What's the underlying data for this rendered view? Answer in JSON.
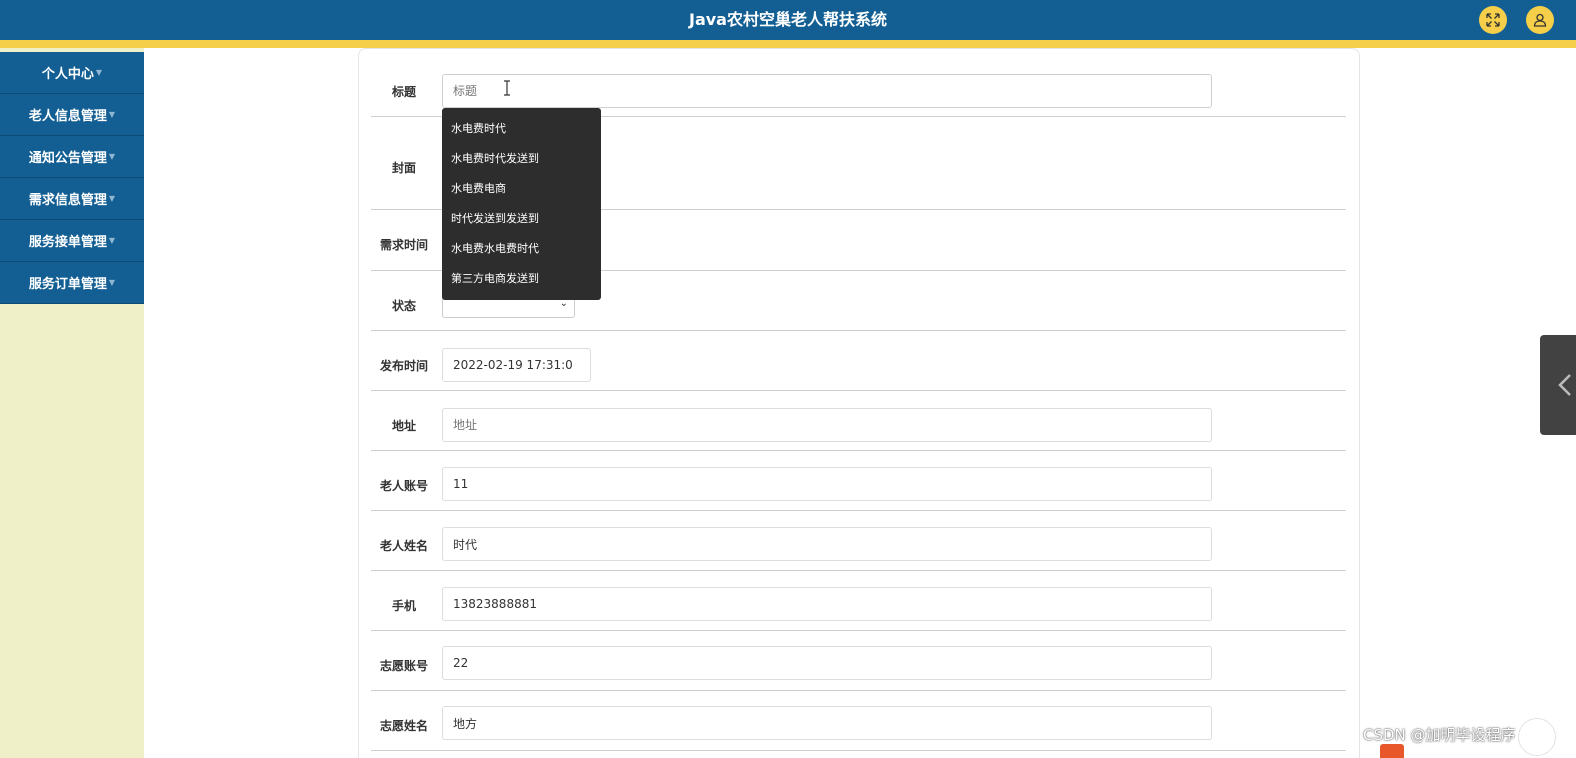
{
  "header": {
    "title": "Java农村空巢老人帮扶系统",
    "fullscreen_icon": "expand-icon",
    "user_icon": "user-icon"
  },
  "sidebar": {
    "items": [
      {
        "label": "个人中心"
      },
      {
        "label": "老人信息管理"
      },
      {
        "label": "通知公告管理"
      },
      {
        "label": "需求信息管理"
      },
      {
        "label": "服务接单管理"
      },
      {
        "label": "服务订单管理"
      }
    ]
  },
  "form": {
    "title": {
      "label": "标题",
      "placeholder": "标题",
      "value": ""
    },
    "cover": {
      "label": "封面"
    },
    "demand_time": {
      "label": "需求时间"
    },
    "status": {
      "label": "状态",
      "value": ""
    },
    "publish_time": {
      "label": "发布时间",
      "value": "2022-02-19 17:31:0"
    },
    "address": {
      "label": "地址",
      "placeholder": "地址",
      "value": ""
    },
    "elder_account": {
      "label": "老人账号",
      "value": "11"
    },
    "elder_name": {
      "label": "老人姓名",
      "value": "时代"
    },
    "phone": {
      "label": "手机",
      "value": "13823888881"
    },
    "volunteer_account": {
      "label": "志愿账号",
      "value": "22"
    },
    "volunteer_name": {
      "label": "志愿姓名",
      "value": "地方"
    }
  },
  "autocomplete": {
    "items": [
      "水电费时代",
      "水电费时代发送到",
      "水电费电商",
      "时代发送到发送到",
      "水电费水电费时代",
      "第三方电商发送到"
    ]
  },
  "watermark": {
    "text": "CSDN @加明毕设程序"
  },
  "colors": {
    "header_bg": "#135f94",
    "accent_yellow": "#f6cf4a",
    "sidebar_bg": "#efefc8"
  }
}
